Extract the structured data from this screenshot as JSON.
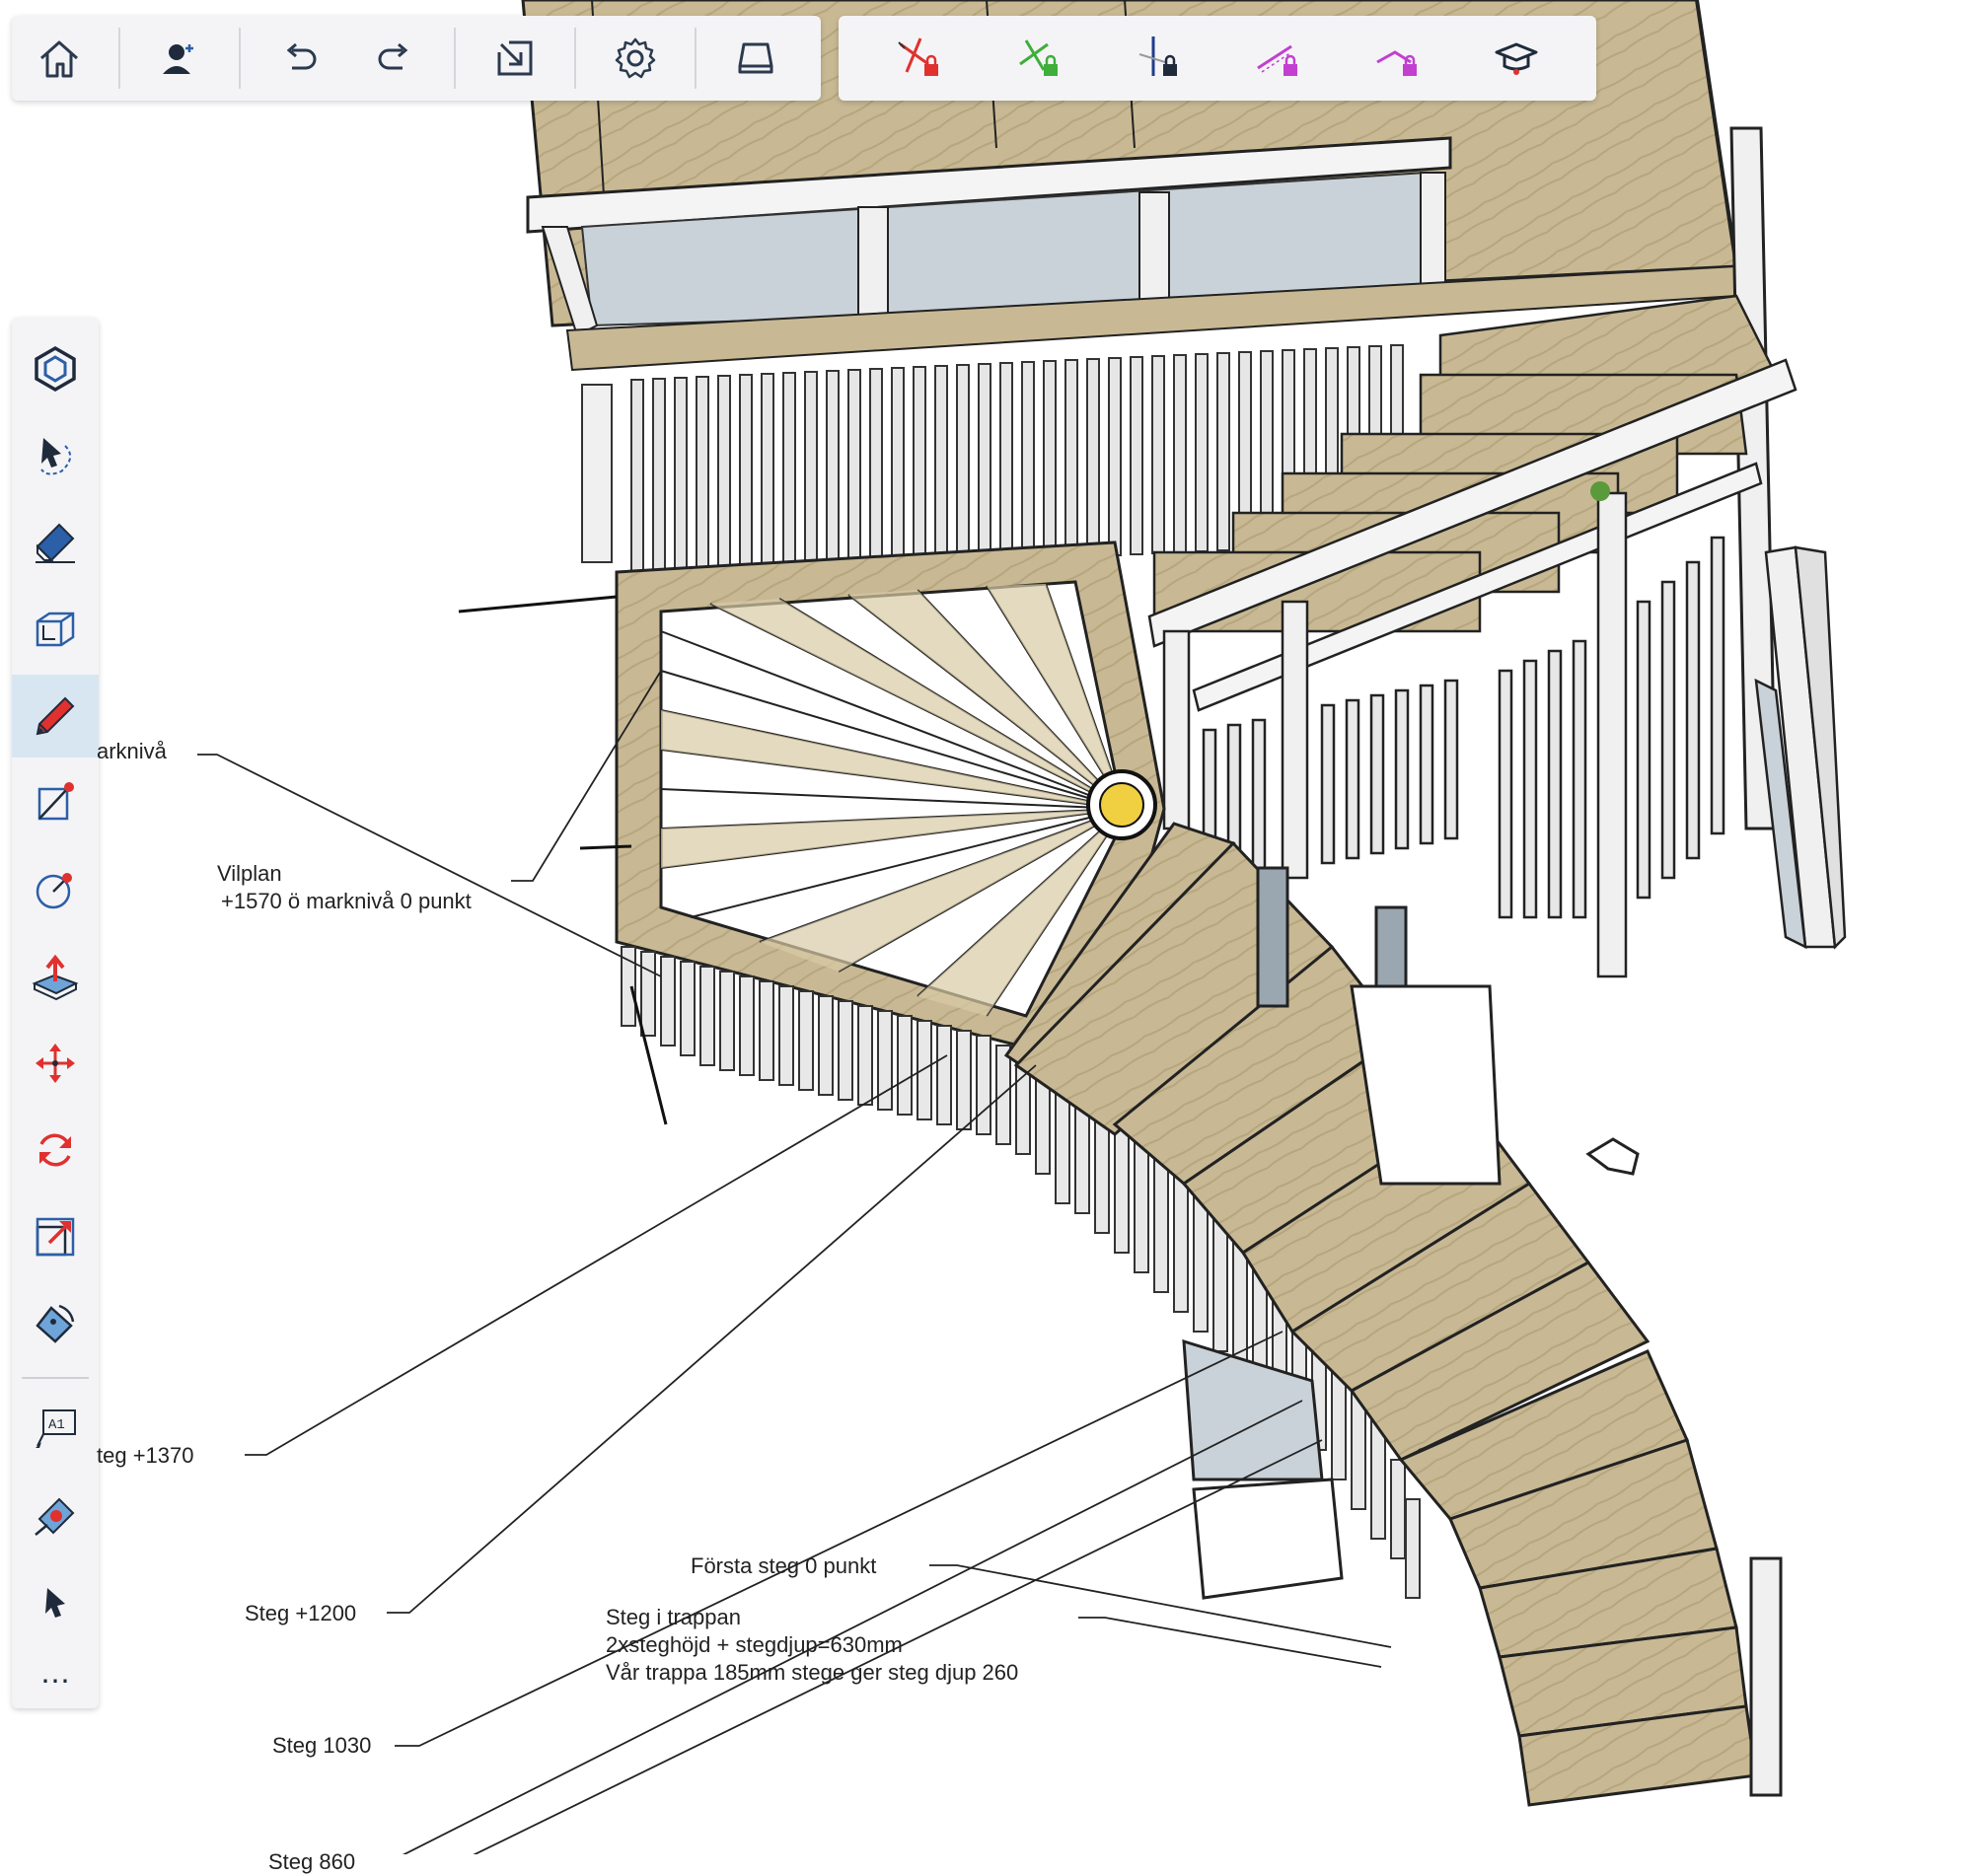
{
  "toolbar": {
    "main_icons": [
      "home-icon",
      "add-user-icon",
      "undo-icon",
      "redo-icon",
      "export-icon",
      "gear-icon",
      "storage-icon"
    ],
    "axis_icons": [
      "lock-red-axis-icon",
      "lock-green-axis-icon",
      "lock-blue-axis-icon",
      "lock-magenta-inference-icon",
      "lock-magenta-parallel-icon",
      "instructor-cap-icon"
    ],
    "axis_colors": {
      "red": "#e0312e",
      "green": "#3fae3a",
      "blue": "#1f3b8c",
      "magenta": "#c23fd0"
    }
  },
  "sidebar": {
    "tools": [
      "components-icon",
      "lasso-select-icon",
      "eraser-icon",
      "section-plane-icon",
      "pencil-icon",
      "line-icon",
      "circle-icon",
      "push-pull-icon",
      "move-icon",
      "rotate-icon",
      "scale-icon",
      "paint-bucket-icon",
      "text-icon",
      "tape-measure-icon",
      "pointer-icon",
      "more-icon"
    ],
    "active_tool": "pencil-icon",
    "more_label": "⋯"
  },
  "annotations": {
    "marknivå": "arknivå",
    "vilplan_line1": "Vilplan",
    "vilplan_line2": "+1570 ö marknivå 0 punkt",
    "steg_1370": "teg +1370",
    "steg_1200": "Steg +1200",
    "steg_1030": "Steg 1030",
    "steg_860": "Steg 860",
    "forsta_steg": "Första steg 0 punkt",
    "steg_trappan_1": "Steg i trappan",
    "steg_trappan_2": "2xsteghöjd + stegdjup=630mm",
    "steg_trappan_3": "Vår trappa 185mm stege ger steg djup 260"
  },
  "colors": {
    "wood": "#c8b994",
    "wood_dark": "#a99872",
    "white_board": "#f4f4f4",
    "glass": "#c9d2d8",
    "accent_blue": "#2b5fa8",
    "inference_dot": "#f0d040"
  }
}
